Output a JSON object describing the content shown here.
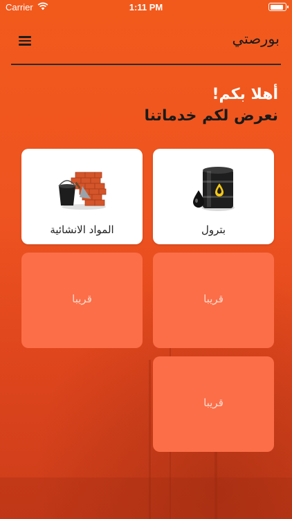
{
  "status_bar": {
    "carrier": "Carrier",
    "time": "1:11 PM",
    "battery_level": 0.85
  },
  "header": {
    "title": "بورصتي",
    "menu_icon": "hamburger-menu-icon"
  },
  "greeting": {
    "line1": "أهلا بكم!",
    "line2": "نعرض لكم خدماتنا"
  },
  "cards": [
    {
      "label": "بترول",
      "icon": "oil-barrel-icon",
      "state": "active"
    },
    {
      "label": "المواد الانشائية",
      "icon": "bricks-bucket-icon",
      "state": "active"
    },
    {
      "label": "قريبا",
      "state": "coming-soon"
    },
    {
      "label": "قريبا",
      "state": "coming-soon"
    },
    {
      "label": "قريبا",
      "state": "coming-soon"
    }
  ],
  "colors": {
    "background": "#ee5420",
    "card_active": "#ffffff",
    "card_soon": "#fb6e48",
    "greeting_white": "#ffffff",
    "text_dark": "#1a1a1a"
  }
}
